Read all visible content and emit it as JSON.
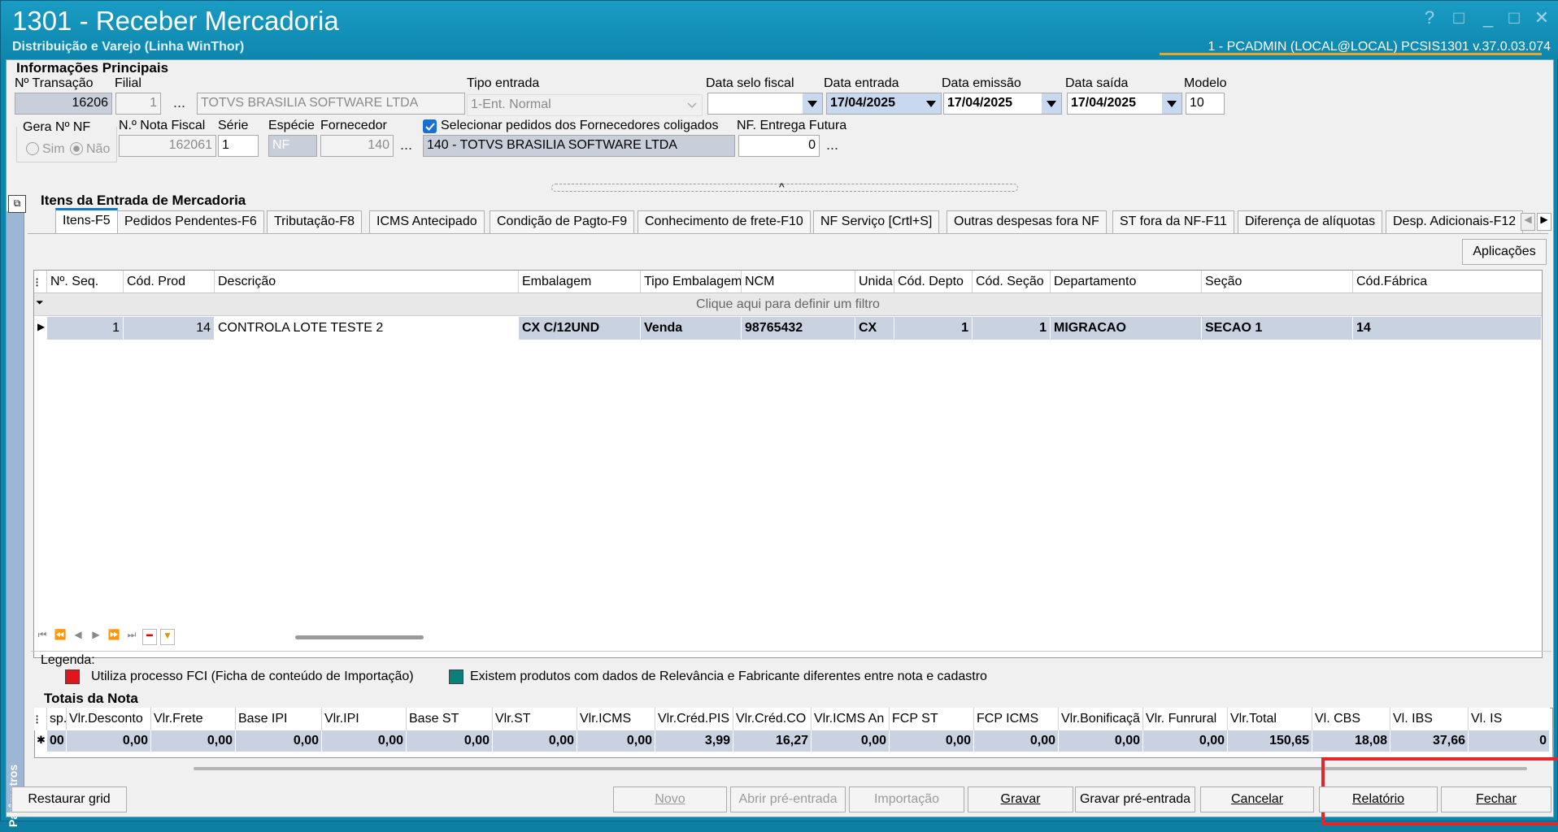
{
  "window": {
    "title": "1301 - Receber Mercadoria",
    "subtitle": "Distribuição e Varejo (Linha WinThor)",
    "user_info": "1 - PCADMIN (LOCAL@LOCAL)   PCSIS1301  v.37.0.03.074",
    "controls": [
      "?",
      "□",
      "_",
      "□",
      "✕"
    ]
  },
  "info": {
    "section_title": "Informações Principais",
    "labels": {
      "n_transacao": "Nº Transação",
      "filial": "Filial",
      "tipo_entrada": "Tipo entrada",
      "data_selo_fiscal": "Data selo fiscal",
      "data_entrada": "Data entrada",
      "data_emissao": "Data emissão",
      "data_saida": "Data saída",
      "modelo": "Modelo",
      "gera_nf": "Gera Nº NF",
      "nota_fiscal": "N.º Nota Fiscal",
      "serie": "Série",
      "especie": "Espécie",
      "fornecedor": "Fornecedor",
      "selecionar_pedidos": "Selecionar pedidos dos Fornecedores coligados",
      "nf_entrega_futura": "NF. Entrega Futura",
      "sim": "Sim",
      "nao": "Não"
    },
    "values": {
      "n_transacao": "16206",
      "filial": "1",
      "filial_nome": "TOTVS BRASILIA SOFTWARE LTDA",
      "tipo_entrada": "1-Ent. Normal",
      "data_selo_fiscal": "",
      "data_entrada": "17/04/2025",
      "data_emissao": "17/04/2025",
      "data_saida": "17/04/2025",
      "modelo": "10",
      "nota_fiscal": "162061",
      "serie": "1",
      "especie": "NF",
      "fornecedor": "140",
      "fornecedor_nome": "140 - TOTVS BRASILIA SOFTWARE LTDA",
      "nf_entrega_futura": "0",
      "ellipsis": "..."
    }
  },
  "items_section": {
    "title": "Itens da Entrada de Mercadoria",
    "tabs": [
      "Itens-F5",
      "Pedidos Pendentes-F6",
      "Tributação-F8",
      "ICMS Antecipado",
      "Condição de Pagto-F9",
      "Conhecimento de frete-F10",
      "NF Serviço [Crtl+S]",
      "Outras despesas fora NF",
      "ST fora da NF-F11",
      "Diferença de alíquotas",
      "Desp. Adicionais-F12"
    ],
    "aplicacoes": "Aplicações",
    "columns": [
      "Nº. Seq.",
      "Cód. Prod",
      "Descrição",
      "Embalagem",
      "Tipo Embalagem",
      "NCM",
      "Unida",
      "Cód. Depto",
      "Cód. Seção",
      "Departamento",
      "Seção",
      "Cód.Fábrica"
    ],
    "filter_hint": "Clique aqui para definir um filtro",
    "rows": [
      [
        "1",
        "14",
        "CONTROLA LOTE TESTE 2",
        "CX C/12UND",
        "Venda",
        "98765432",
        "CX",
        "1",
        "1",
        "MIGRACAO",
        "SECAO 1",
        "14"
      ]
    ]
  },
  "legend": {
    "title": "Legenda:",
    "items": [
      {
        "color": "#e3141b",
        "label": "Utiliza processo FCI (Ficha de conteúdo de Importação)"
      },
      {
        "color": "#0b7f7c",
        "label": "Existem produtos com dados de Relevância e Fabricante diferentes entre nota e cadastro"
      }
    ]
  },
  "totals": {
    "title": "Totais da Nota",
    "columns": [
      "sp.",
      "Vlr.Desconto",
      "Vlr.Frete",
      "Base IPI",
      "Vlr.IPI",
      "Base ST",
      "Vlr.ST",
      "Vlr.ICMS",
      "Vlr.Créd.PIS",
      "Vlr.Créd.CO",
      "Vlr.ICMS An",
      "FCP ST",
      "FCP ICMS",
      "Vlr.Bonificaçã",
      "Vlr. Funrural",
      "Vlr.Total",
      "Vl. CBS",
      "Vl. IBS",
      "Vl. IS"
    ],
    "values": [
      "00",
      "0,00",
      "0,00",
      "0,00",
      "0,00",
      "0,00",
      "0,00",
      "0,00",
      "3,99",
      "16,27",
      "0,00",
      "0,00",
      "0,00",
      "0,00",
      "0,00",
      "150,65",
      "18,08",
      "37,66",
      "0"
    ]
  },
  "side_panel": {
    "label": "Parâmetros"
  },
  "buttons": {
    "restaurar": "Restaurar grid",
    "novo": "Novo",
    "abrir_pre": "Abrir pré-entrada",
    "importacao": "Importação",
    "gravar": "Gravar",
    "gravar_pre": "Gravar pré-entrada",
    "cancelar": "Cancelar",
    "relatorio": "Relatório",
    "fechar": "Fechar"
  },
  "colors": {
    "title_bar": "#0d86ad",
    "highlight": "#e2262b",
    "row_selected": "#c8d2e1",
    "accent": "#1479c9"
  }
}
